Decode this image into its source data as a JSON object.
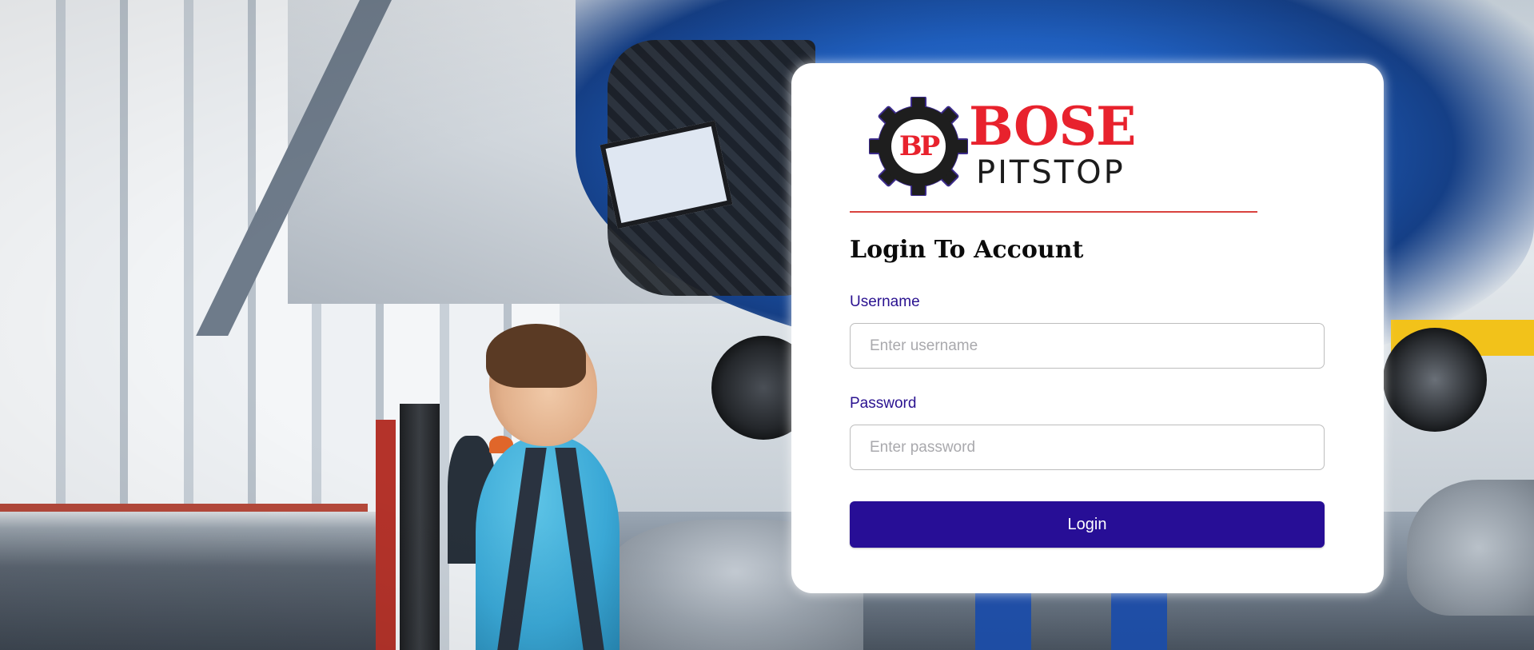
{
  "logo": {
    "monogram": "BP",
    "brand_line1": "BOSE",
    "brand_line2": "PITSTOP",
    "colors": {
      "red": "#e8222d",
      "dark": "#1c1c1c",
      "gear_ring": "#3b2a8a"
    }
  },
  "login": {
    "title": "Login To Account",
    "username_label": "Username",
    "username_placeholder": "Enter username",
    "username_value": "",
    "password_label": "Password",
    "password_placeholder": "Enter password",
    "password_value": "",
    "submit_label": "Login"
  },
  "theme": {
    "accent": "#270e96",
    "label_color": "#2a1290",
    "divider_color": "#d9423e"
  },
  "background": {
    "scene": "auto repair garage with mechanic and lifted blue car"
  }
}
